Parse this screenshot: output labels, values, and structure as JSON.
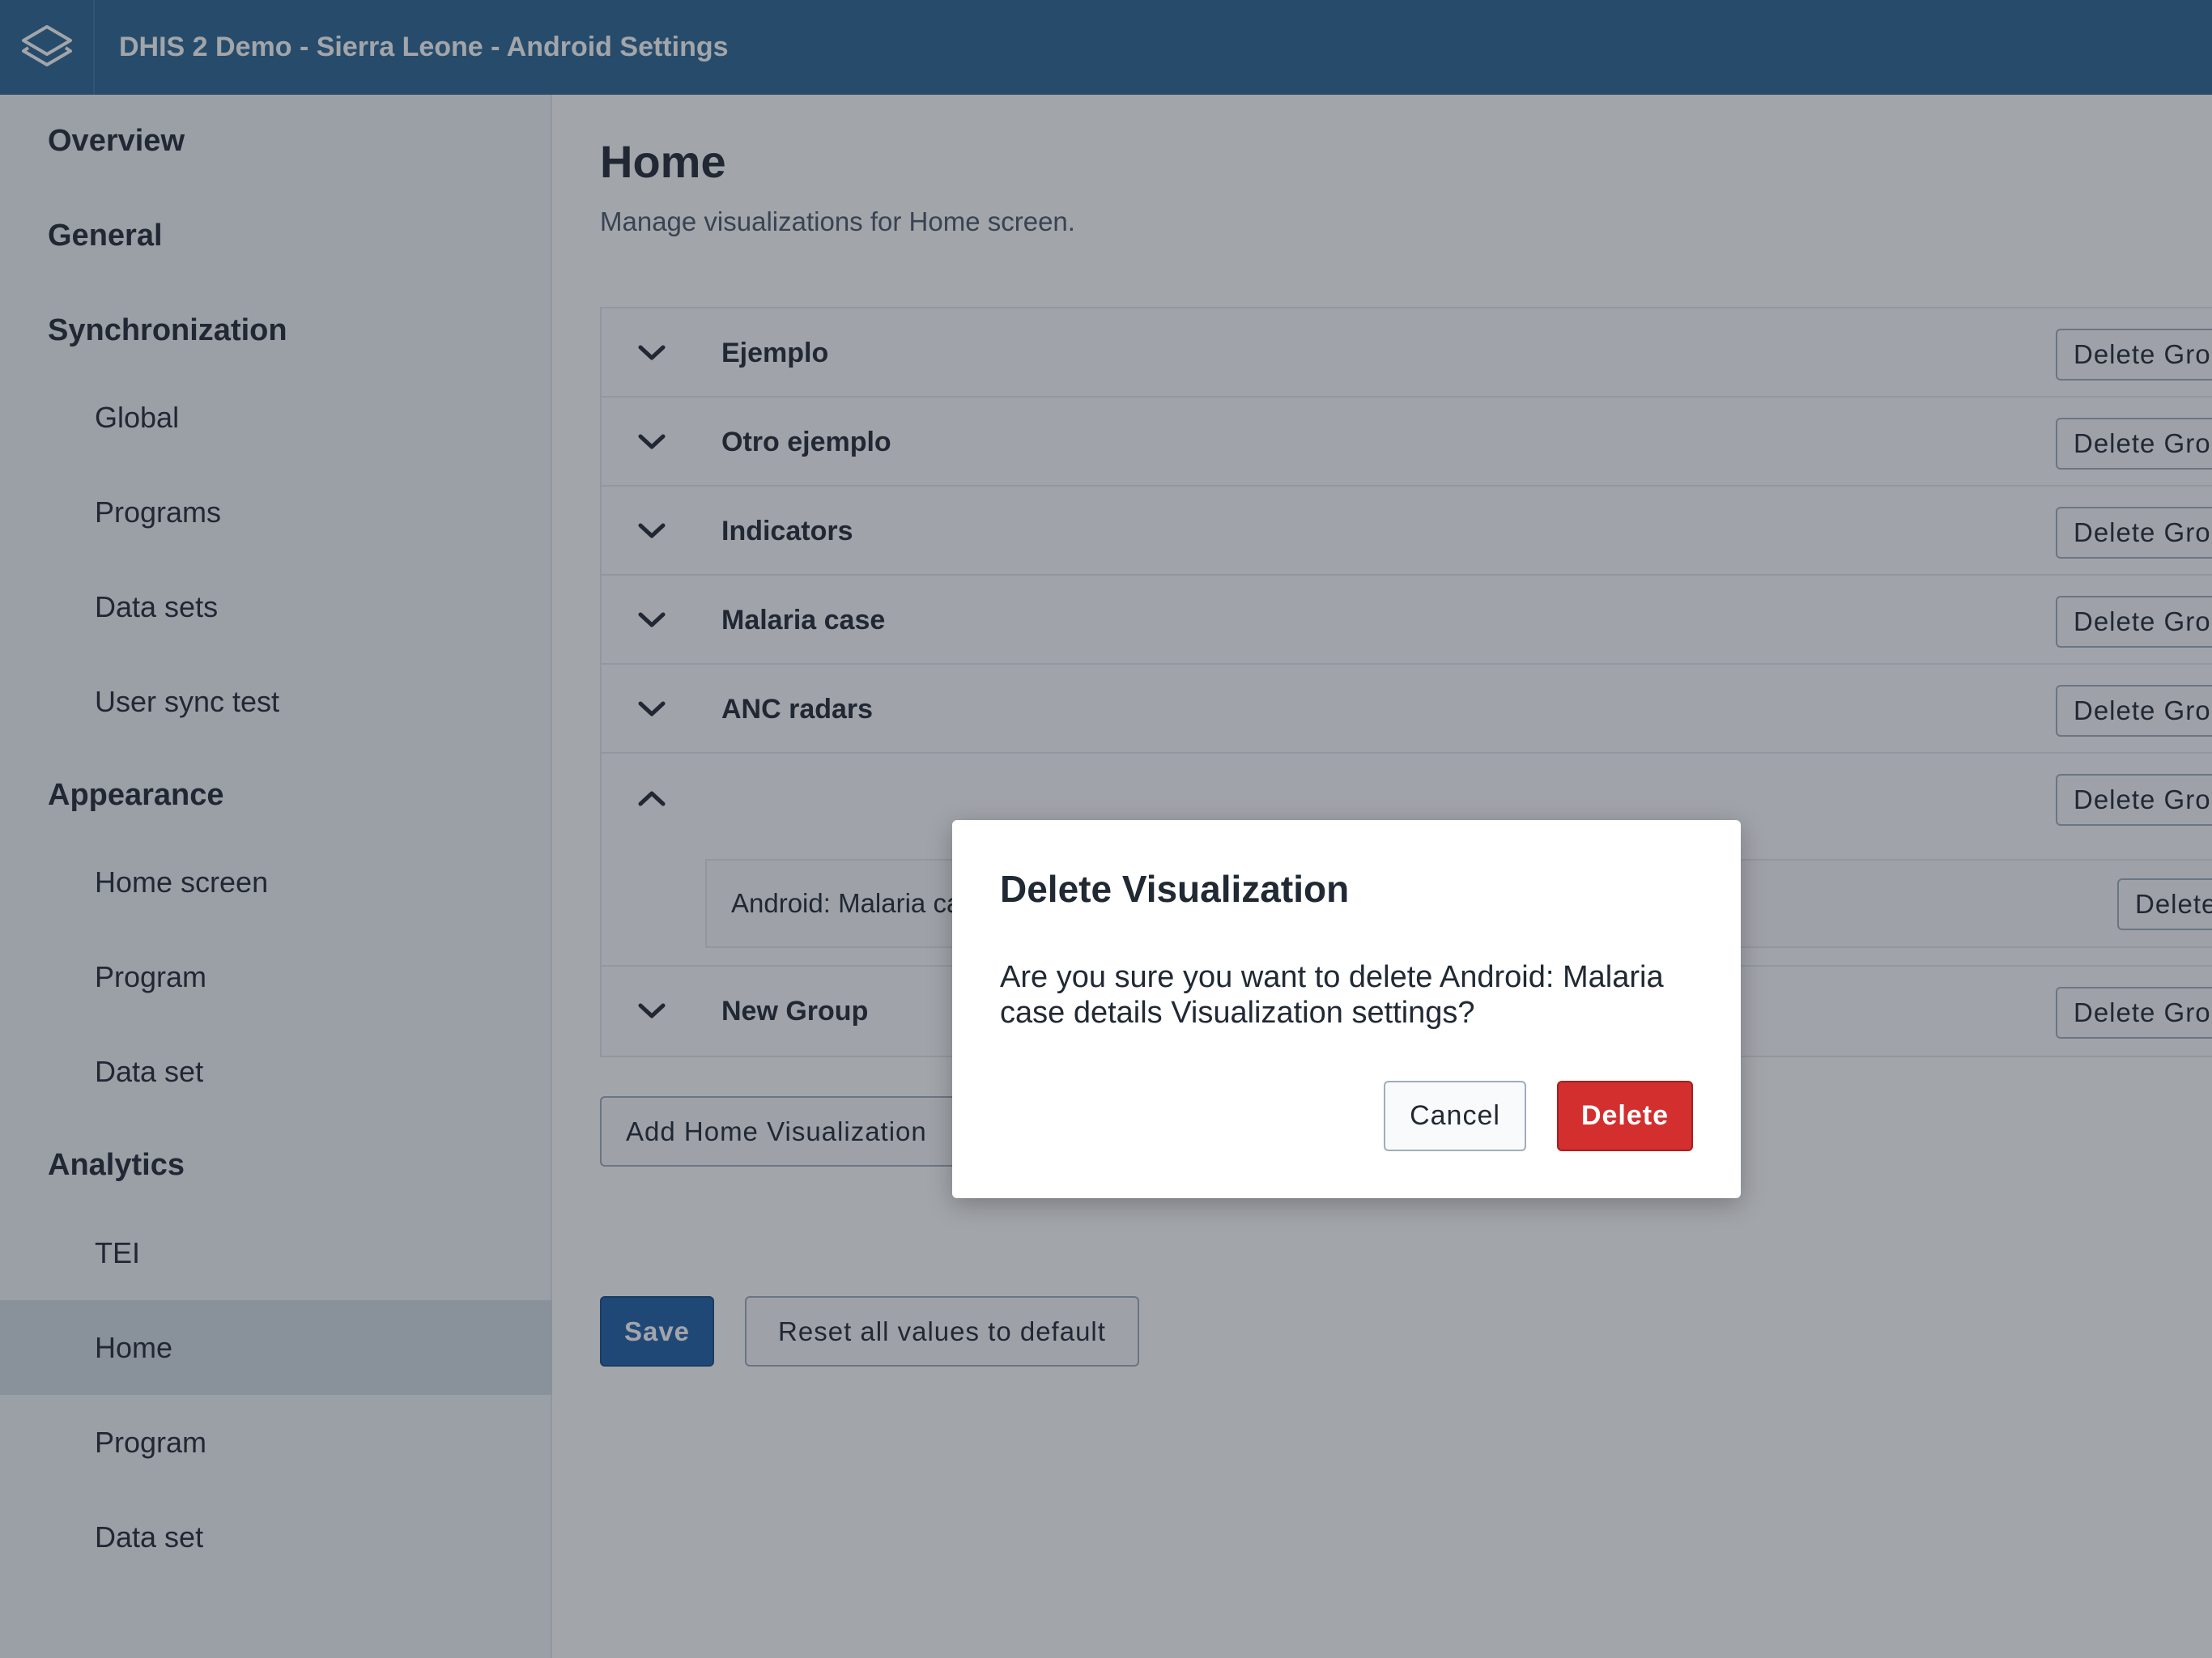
{
  "header": {
    "title": "DHIS 2 Demo - Sierra Leone - Android Settings"
  },
  "sidebar": {
    "items": [
      {
        "label": "Overview",
        "level": "section"
      },
      {
        "label": "General",
        "level": "section"
      },
      {
        "label": "Synchronization",
        "level": "section"
      },
      {
        "label": "Global",
        "level": "sub"
      },
      {
        "label": "Programs",
        "level": "sub"
      },
      {
        "label": "Data sets",
        "level": "sub"
      },
      {
        "label": "User sync test",
        "level": "sub"
      },
      {
        "label": "Appearance",
        "level": "section"
      },
      {
        "label": "Home screen",
        "level": "sub"
      },
      {
        "label": "Program",
        "level": "sub"
      },
      {
        "label": "Data set",
        "level": "sub"
      },
      {
        "label": "Analytics",
        "level": "section"
      },
      {
        "label": "TEI",
        "level": "sub"
      },
      {
        "label": "Home",
        "level": "sub",
        "active": true
      },
      {
        "label": "Program",
        "level": "sub"
      },
      {
        "label": "Data set",
        "level": "sub"
      }
    ]
  },
  "main": {
    "title": "Home",
    "description": "Manage visualizations for Home screen.",
    "delete_group_label": "Delete Group",
    "groups": [
      {
        "name": "Ejemplo",
        "expanded": false
      },
      {
        "name": "Otro ejemplo",
        "expanded": false
      },
      {
        "name": "Indicators",
        "expanded": false
      },
      {
        "name": "Malaria case",
        "expanded": false
      },
      {
        "name": "ANC radars",
        "expanded": false
      },
      {
        "name": "",
        "expanded": true,
        "visualizations": [
          {
            "name": "Android: Malaria case details",
            "delete_label": "Delete"
          }
        ]
      },
      {
        "name": "New Group",
        "expanded": false
      }
    ],
    "add_button": "Add Home Visualization",
    "save_button": "Save",
    "reset_button": "Reset all values to default"
  },
  "modal": {
    "title": "Delete Visualization",
    "body": "Are you sure you want to delete Android: Malaria case details Visualization settings?",
    "cancel": "Cancel",
    "delete": "Delete"
  },
  "colors": {
    "header": "#2c6693",
    "primary": "#1f5fa8",
    "destructive": "#d32f2f",
    "active_nav": "#d5dde5"
  },
  "icons": {
    "logo": "dhis2-logo-icon",
    "collapsed": "chevron-down-icon",
    "expanded": "chevron-up-icon"
  }
}
